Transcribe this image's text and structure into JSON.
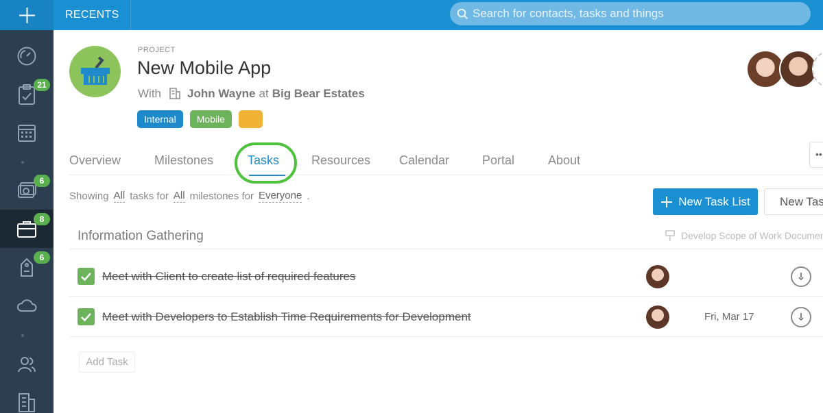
{
  "topbar": {
    "recents_label": "RECENTS",
    "search_placeholder": "Search for contacts, tasks and things"
  },
  "sidebar": {
    "items": [
      {
        "name": "dashboard-icon"
      },
      {
        "name": "tasks-icon",
        "badge": "21"
      },
      {
        "name": "calendar-icon"
      },
      {
        "name": "money-icon",
        "badge": "6"
      },
      {
        "name": "projects-icon",
        "badge": "8",
        "active": true
      },
      {
        "name": "tag-icon",
        "badge": "6"
      },
      {
        "name": "cloud-icon"
      },
      {
        "name": "contacts-icon"
      },
      {
        "name": "companies-icon"
      }
    ]
  },
  "project": {
    "kicker": "PROJECT",
    "title": "New Mobile App",
    "with_label": "With",
    "contact": "John Wayne",
    "at_label": "at",
    "company": "Big Bear Estates",
    "tags": [
      {
        "label": "Internal",
        "color": "#1f8ac9"
      },
      {
        "label": "Mobile",
        "color": "#6db35b"
      },
      {
        "label": "",
        "color": "#f0b335"
      }
    ]
  },
  "tabs": [
    "Overview",
    "Milestones",
    "Tasks",
    "Resources",
    "Calendar",
    "Portal",
    "About"
  ],
  "active_tab": "Tasks",
  "filters": {
    "showing": "Showing",
    "all_tasks": "All",
    "tasks_for": "tasks for",
    "all_milestones": "All",
    "milestones_for": "milestones for",
    "everyone": "Everyone",
    "period": "."
  },
  "actions": {
    "new_task_list": "New Task List",
    "new_task": "New Task"
  },
  "task_list": {
    "title": "Information Gathering",
    "milestone": "Develop Scope of Work Document",
    "tasks": [
      {
        "text": "Meet with Client to create list of required features",
        "due": "",
        "completed": true
      },
      {
        "text": "Meet with Developers to Establish Time Requirements for Development",
        "due": "Fri, Mar 17",
        "completed": true
      }
    ],
    "add_task": "Add Task"
  },
  "colors": {
    "topbar": "#1a8fd1",
    "sidebar": "#2c3e50",
    "accent": "#1f8ac9",
    "success": "#6db35b",
    "highlight": "#4ec23d"
  }
}
